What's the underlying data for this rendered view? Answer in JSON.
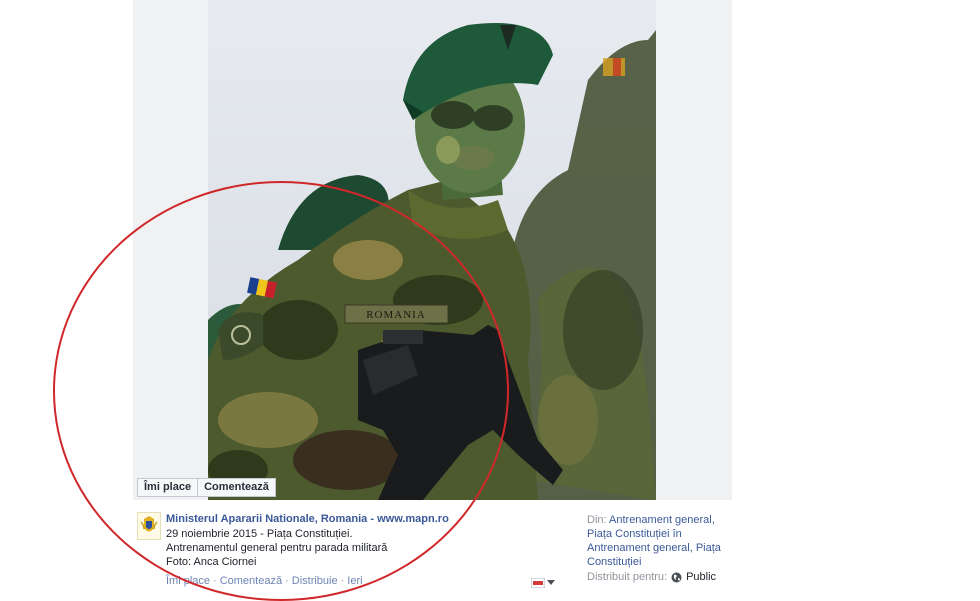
{
  "photo": {
    "patch_text": "ROMANIA"
  },
  "photo_actions": {
    "like": "Îmi place",
    "comment": "Comentează"
  },
  "post": {
    "page_name": "Ministerul Apararii Nationale, Romania - www.mapn.ro",
    "date_location": "29 noiembrie 2015 - Piața Constituției.",
    "caption": "Antrenamentul general pentru parada militară",
    "credit": "Foto: Anca Ciornei"
  },
  "actions": {
    "like": "Îmi place",
    "comment": "Comentează",
    "share": "Distribuie",
    "time": "Ieri",
    "separator": "·"
  },
  "album_info": {
    "from_label": "Din:",
    "album_line": "Antrenament general, Piața Constituției în Antrenament general, Piața Constituției",
    "shared_label": "Distribuit pentru:",
    "audience": "Public",
    "audience_icon": "globe-icon"
  },
  "annotation": {
    "color": "#d0282a"
  }
}
